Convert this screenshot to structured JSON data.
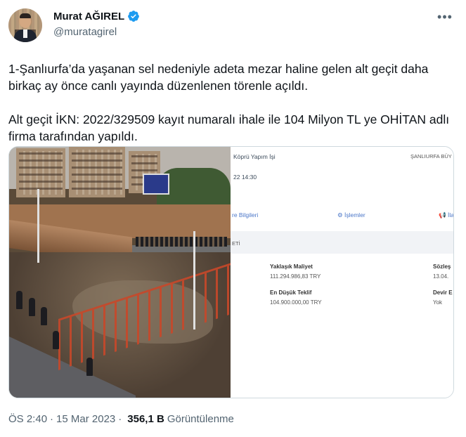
{
  "author": {
    "display_name": "Murat AĞIREL",
    "handle": "@muratagirel",
    "verified": true
  },
  "tweet": {
    "paragraph_1": "1-Şanlıurfa’da yaşanan sel nedeniyle adeta mezar haline gelen alt geçit daha birkaç ay önce canlı yayında düzenlenen törenle açıldı.",
    "paragraph_2": "Alt geçit İKN: 2022/329509 kayıt numaralı ihale ile 104 Milyon TL ye OHİTAN adlı firma tarafından yapıldı."
  },
  "screenshot": {
    "title": "Köprü Yapım İşi",
    "org": "ŞANLIURFA BÜY",
    "datetime": "22 14:30",
    "tabs": [
      "re Bilgileri",
      "İşlemler",
      "İlan"
    ],
    "section": "ETİ",
    "fields": [
      {
        "label": "Yaklaşık Maliyet",
        "value": "111.294.986,83 TRY"
      },
      {
        "label": "Sözleş",
        "value": "13.04."
      },
      {
        "label": "En Düşük Teklif",
        "value": "104.900.000,00 TRY"
      },
      {
        "label": "Devir E",
        "value": "Yok"
      }
    ]
  },
  "footer": {
    "time": "ÖS 2:40",
    "date": "15 Mar 2023",
    "views": "356,1 B",
    "views_label": "Görüntülenme"
  },
  "colors": {
    "verified": "#1d9bf0",
    "text": "#0f1419",
    "muted": "#536471",
    "link_tab": "#4a76c8"
  },
  "icons": [
    "verified-badge-icon",
    "more-options-icon",
    "gear-icon",
    "megaphone-icon"
  ]
}
